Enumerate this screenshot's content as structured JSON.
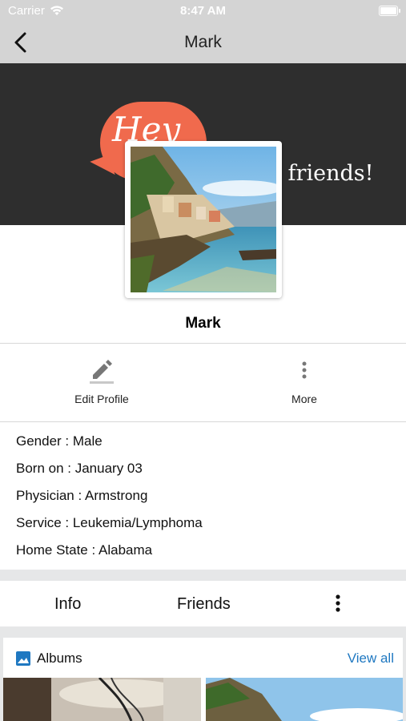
{
  "status_bar": {
    "carrier": "Carrier",
    "time": "8:47 AM",
    "battery_level": 1.0
  },
  "nav": {
    "title": "Mark",
    "back_icon": "chevron-left-icon"
  },
  "banner": {
    "bubble_text": "Hey",
    "tagline": "e friends!"
  },
  "profile": {
    "name": "Mark"
  },
  "actions": [
    {
      "label": "Edit Profile",
      "icon": "pencil-icon"
    },
    {
      "label": "More",
      "icon": "more-vertical-icon"
    }
  ],
  "details": [
    "Gender : Male",
    "Born on : January 03",
    "Physician : Armstrong",
    "Service : Leukemia/Lymphoma",
    "Home State : Alabama"
  ],
  "tabs": [
    {
      "label": "Info"
    },
    {
      "label": "Friends"
    }
  ],
  "albums": {
    "title": "Albums",
    "view_all": "View all",
    "icon": "image-icon"
  },
  "colors": {
    "link": "#1f78c1",
    "bubble": "#f06a4d",
    "banner": "#2e2e2e",
    "nav": "#d4d4d4"
  }
}
